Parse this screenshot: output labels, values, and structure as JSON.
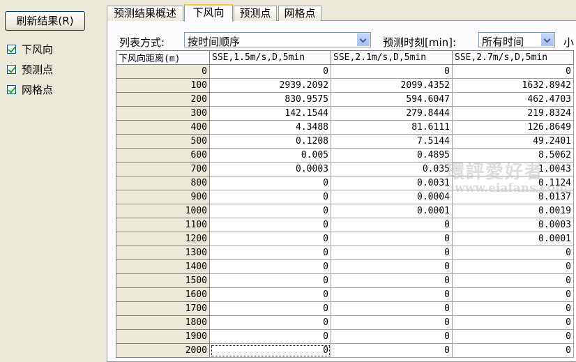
{
  "left_panel": {
    "refresh_button": "刷新结果(R)",
    "checkboxes": [
      {
        "label": "下风向",
        "checked": true
      },
      {
        "label": "预测点",
        "checked": true
      },
      {
        "label": "网格点",
        "checked": true
      }
    ]
  },
  "tabs": [
    {
      "label": "预测结果概述",
      "active": false
    },
    {
      "label": "下风向",
      "active": true
    },
    {
      "label": "预测点",
      "active": false
    },
    {
      "label": "网格点",
      "active": false
    }
  ],
  "controls": {
    "order_label": "列表方式:",
    "order_value": "按时间顺序",
    "time_label": "预测时刻[min]:",
    "time_value": "所有时间",
    "small_label": "小"
  },
  "table": {
    "headers": [
      "下风向距离(m)",
      "SSE,1.5m/s,D,5min",
      "SSE,2.1m/s,D,5min",
      "SSE,2.7m/s,D,5min"
    ],
    "rows": [
      [
        "0",
        "0",
        "0",
        "0"
      ],
      [
        "100",
        "2939.2092",
        "2099.4352",
        "1632.8942"
      ],
      [
        "200",
        "830.9575",
        "594.6047",
        "462.4703"
      ],
      [
        "300",
        "142.1544",
        "279.8444",
        "219.8324"
      ],
      [
        "400",
        "4.3488",
        "81.6111",
        "126.8649"
      ],
      [
        "500",
        "0.1208",
        "7.5144",
        "49.2401"
      ],
      [
        "600",
        "0.005",
        "0.4895",
        "8.5062"
      ],
      [
        "700",
        "0.0003",
        "0.035",
        "1.0043"
      ],
      [
        "800",
        "0",
        "0.0031",
        "0.1124"
      ],
      [
        "900",
        "0",
        "0.0004",
        "0.0137"
      ],
      [
        "1000",
        "0",
        "0.0001",
        "0.0019"
      ],
      [
        "1100",
        "0",
        "0",
        "0.0003"
      ],
      [
        "1200",
        "0",
        "0",
        "0.0001"
      ],
      [
        "1300",
        "0",
        "0",
        "0"
      ],
      [
        "1400",
        "0",
        "0",
        "0"
      ],
      [
        "1500",
        "0",
        "0",
        "0"
      ],
      [
        "1600",
        "0",
        "0",
        "0"
      ],
      [
        "1700",
        "0",
        "0",
        "0"
      ],
      [
        "1800",
        "0",
        "0",
        "0"
      ],
      [
        "1900",
        "0",
        "0",
        "0"
      ],
      [
        "2000",
        "0",
        "0",
        "0"
      ]
    ]
  },
  "watermark": {
    "line1": "環評愛好者",
    "line2": "www.eiafans.com"
  }
}
